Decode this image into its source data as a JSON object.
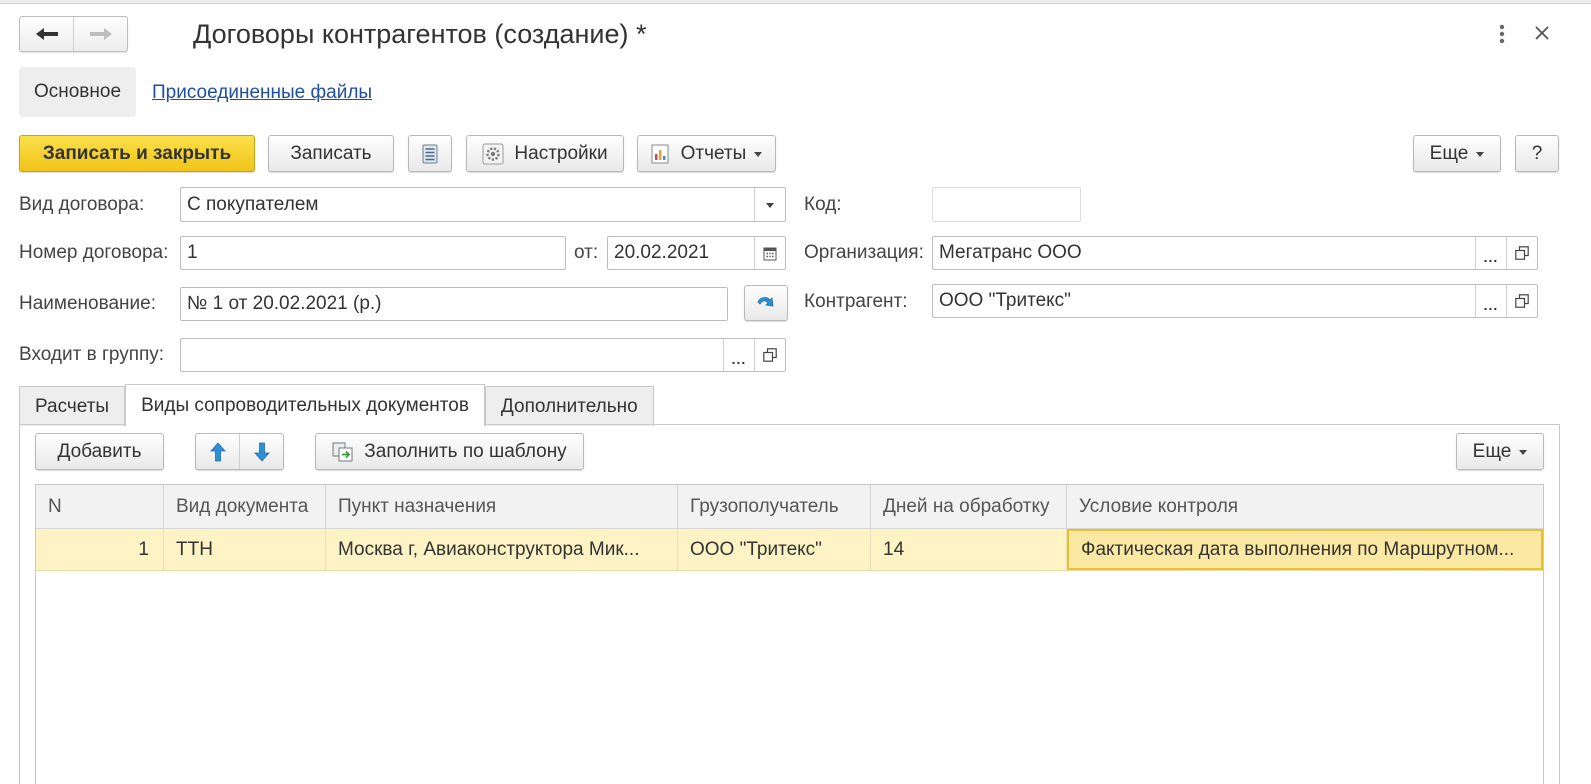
{
  "window": {
    "title": "Договоры контрагентов (создание) *"
  },
  "form_tabs": {
    "main": "Основное",
    "files_link": "Присоединенные файлы"
  },
  "toolbar": {
    "save_close": "Записать и закрыть",
    "save": "Записать",
    "settings": "Настройки",
    "reports": "Отчеты",
    "more": "Еще",
    "help": "?"
  },
  "fields": {
    "contract_type": {
      "label": "Вид договора:",
      "value": "С покупателем"
    },
    "contract_number": {
      "label": "Номер договора:",
      "value": "1"
    },
    "date": {
      "label": "от:",
      "value": "20.02.2021"
    },
    "name": {
      "label": "Наименование:",
      "value": "№ 1 от 20.02.2021 (р.)"
    },
    "group": {
      "label": "Входит в группу:",
      "value": ""
    },
    "code": {
      "label": "Код:",
      "value": ""
    },
    "organization": {
      "label": "Организация:",
      "value": "Мегатранс ООО"
    },
    "counterparty": {
      "label": "Контрагент:",
      "value": "ООО \"Тритекс\""
    }
  },
  "subtabs": [
    {
      "label": "Расчеты",
      "active": false
    },
    {
      "label": "Виды сопроводительных документов",
      "active": true
    },
    {
      "label": "Дополнительно",
      "active": false
    }
  ],
  "table_toolbar": {
    "add": "Добавить",
    "fill_template": "Заполнить по шаблону",
    "more": "Еще"
  },
  "table": {
    "columns": [
      "N",
      "Вид документа",
      "Пункт назначения",
      "Грузополучатель",
      "Дней на обработку",
      "Условие контроля"
    ],
    "rows": [
      [
        "1",
        "ТТН",
        "Москва г, Авиаконструктора Мик...",
        "ООО \"Тритекс\"",
        "14",
        "Фактическая дата выполнения по Маршрутном..."
      ]
    ]
  },
  "colors": {
    "primary_button": "#f5cf2a",
    "selected_row": "#fdf3c5",
    "link": "#1f4fa0",
    "arrow_blue": "#2f8fd6"
  },
  "icons": {
    "back": "arrow-left-icon",
    "forward": "arrow-right-icon",
    "more": "kebab-icon",
    "close": "close-icon",
    "list": "list-icon",
    "settings": "gear-icon",
    "reports": "chart-icon",
    "calendar": "calendar-icon",
    "refresh_name": "curved-arrow-icon",
    "open": "open-window-icon",
    "up": "arrow-up-icon",
    "down": "arrow-down-icon",
    "template": "fill-template-icon"
  }
}
